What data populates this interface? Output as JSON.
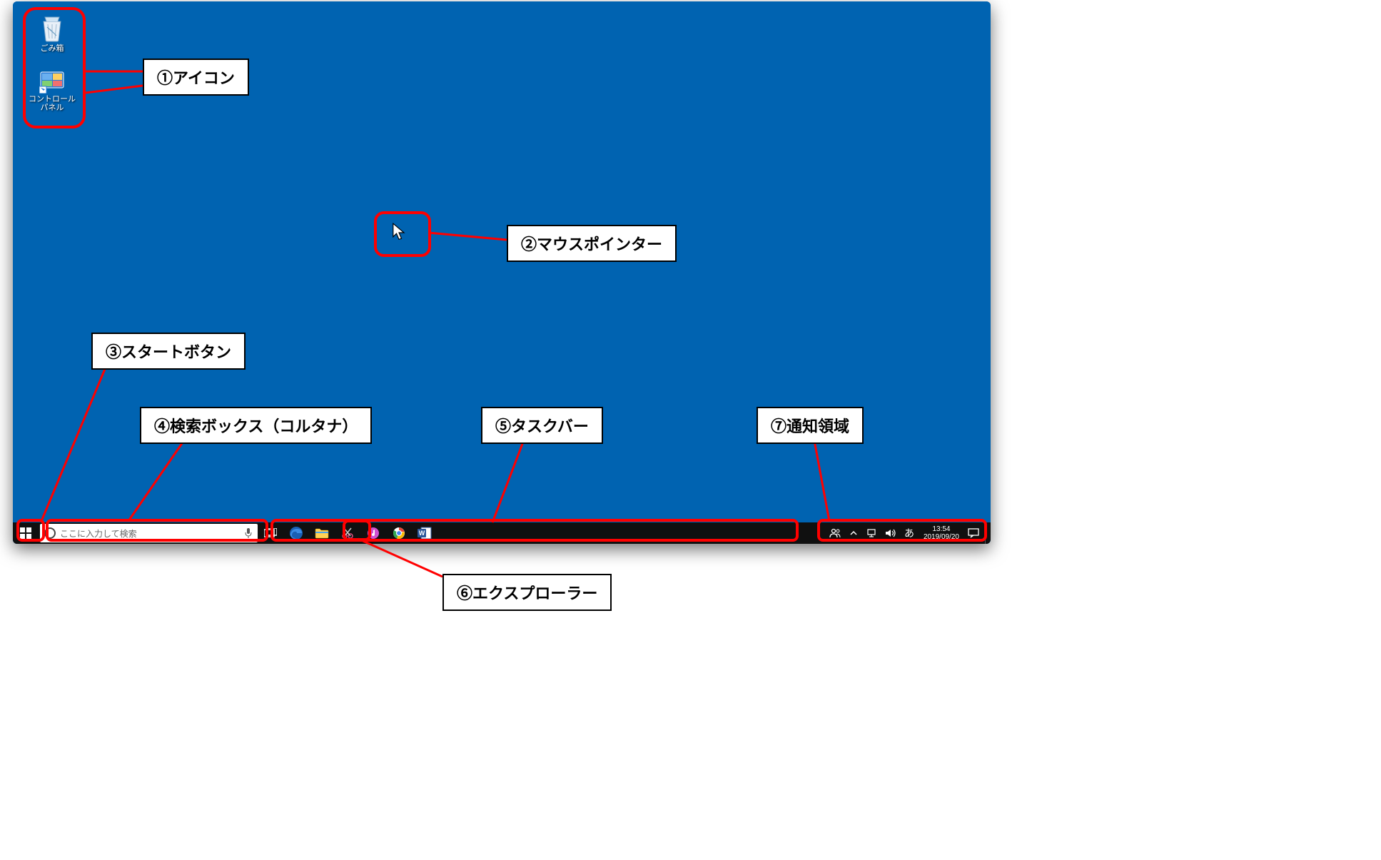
{
  "desktop": {
    "icons": [
      {
        "name": "recycle-bin-icon",
        "label": "ごみ箱"
      },
      {
        "name": "control-panel-icon",
        "label": "コントロール パネル"
      }
    ]
  },
  "taskbar": {
    "search_placeholder": "ここに入力して検索",
    "clock": {
      "time": "13:54",
      "date": "2019/09/20"
    },
    "ime_label": "あ"
  },
  "callouts": {
    "c1": "①アイコン",
    "c2": "②マウスポインター",
    "c3": "③スタートボタン",
    "c4": "④検索ボックス（コルタナ）",
    "c5": "⑤タスクバー",
    "c6": "⑥エクスプローラー",
    "c7": "⑦通知領域"
  }
}
